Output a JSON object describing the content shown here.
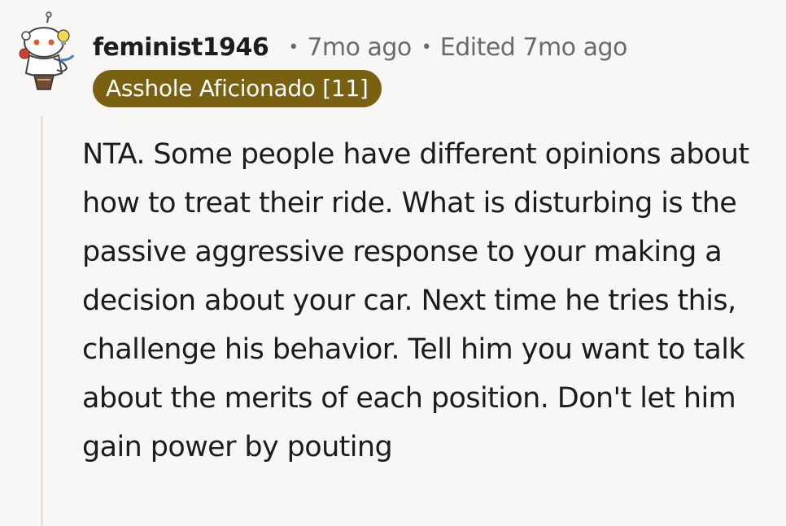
{
  "comment": {
    "username": "feminist1946",
    "time_ago": "7mo ago",
    "edited": "Edited 7mo ago",
    "flair": "Asshole Aficionado [11]",
    "body": "NTA. Some people have different opinions about how to treat their ride. What is disturbing is the passive aggressive response to your making a decision about your car. Next time he tries this, challenge his behavior. Tell him you want to talk about the merits of each position. Don't let him gain power by pouting"
  },
  "colors": {
    "background": "#f8f7f5",
    "flair_bg": "#7a6112",
    "flair_text": "#ffffff",
    "meta_text": "#6b6b6b",
    "thread_line": "#e7e2dc"
  },
  "icons": {
    "avatar": "snoo-avatar-icon"
  }
}
